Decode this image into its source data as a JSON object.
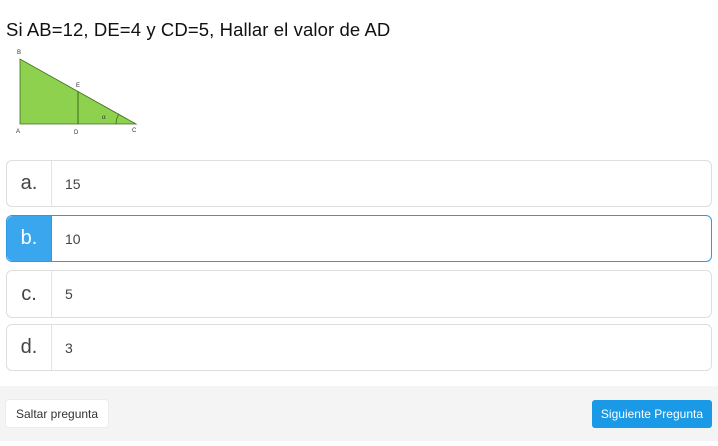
{
  "question": {
    "text": "Si AB=12, DE=4 y CD=5, Hallar el valor de AD"
  },
  "figure": {
    "labels": {
      "b": "B",
      "e": "E",
      "a": "A",
      "d": "D",
      "c": "C",
      "alpha": "α"
    },
    "fill_color": "#8dd14f",
    "stroke_color": "#3e6b1d"
  },
  "options": [
    {
      "letter": "a.",
      "value": "15",
      "selected": false
    },
    {
      "letter": "b.",
      "value": "10",
      "selected": true
    },
    {
      "letter": "c.",
      "value": "5",
      "selected": false
    },
    {
      "letter": "d.",
      "value": "3",
      "selected": false
    }
  ],
  "footer": {
    "skip_label": "Saltar pregunta",
    "next_label": "Siguiente Pregunta"
  },
  "colors": {
    "accent": "#1a9ae6",
    "selected_border": "#2a9be6"
  }
}
